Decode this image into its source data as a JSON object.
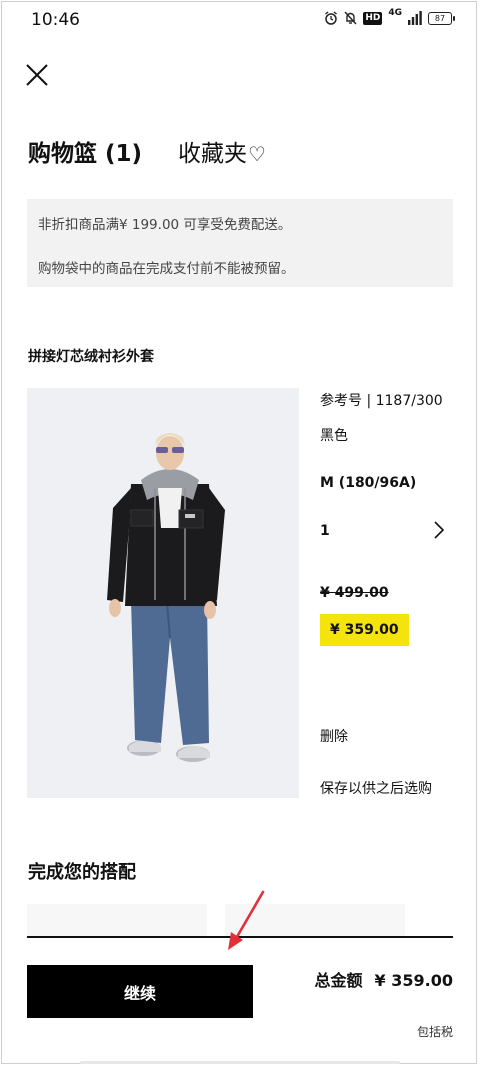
{
  "status_bar": {
    "time": "10:46",
    "network": "4G",
    "hd": "HD",
    "battery": "87",
    "icons": [
      "alarm-icon",
      "bell-mute-icon",
      "hd-icon",
      "signal-icon",
      "battery-icon"
    ]
  },
  "header": {
    "close_icon": "close-icon",
    "basket_tab": "购物篮 (1)",
    "wishlist_tab": "收藏夹",
    "wishlist_icon": "heart-icon"
  },
  "notice": {
    "line1": "非折扣商品满¥ 199.00 可享受免费配送。",
    "line2": "购物袋中的商品在完成支付前不能被预留。"
  },
  "product": {
    "title": "拼接灯芯绒衬衫外套",
    "ref": "参考号 | 1187/300",
    "color": "黑色",
    "size": "M (180/96A)",
    "quantity": "1",
    "original_price": "¥ 499.00",
    "sale_price": "¥ 359.00",
    "delete_label": "删除",
    "save_later_label": "保存以供之后选购",
    "image_label": "product-photo"
  },
  "complete_look": {
    "title": "完成您的搭配"
  },
  "footer": {
    "continue_label": "继续",
    "total_label": "总金额",
    "total_amount": "¥ 359.00",
    "tax_note": "包括税"
  },
  "colors": {
    "sale_highlight": "#f5e30c",
    "button_bg": "#000000",
    "annotation_arrow": "#e0303a",
    "notice_bg": "#f2f2f2"
  }
}
